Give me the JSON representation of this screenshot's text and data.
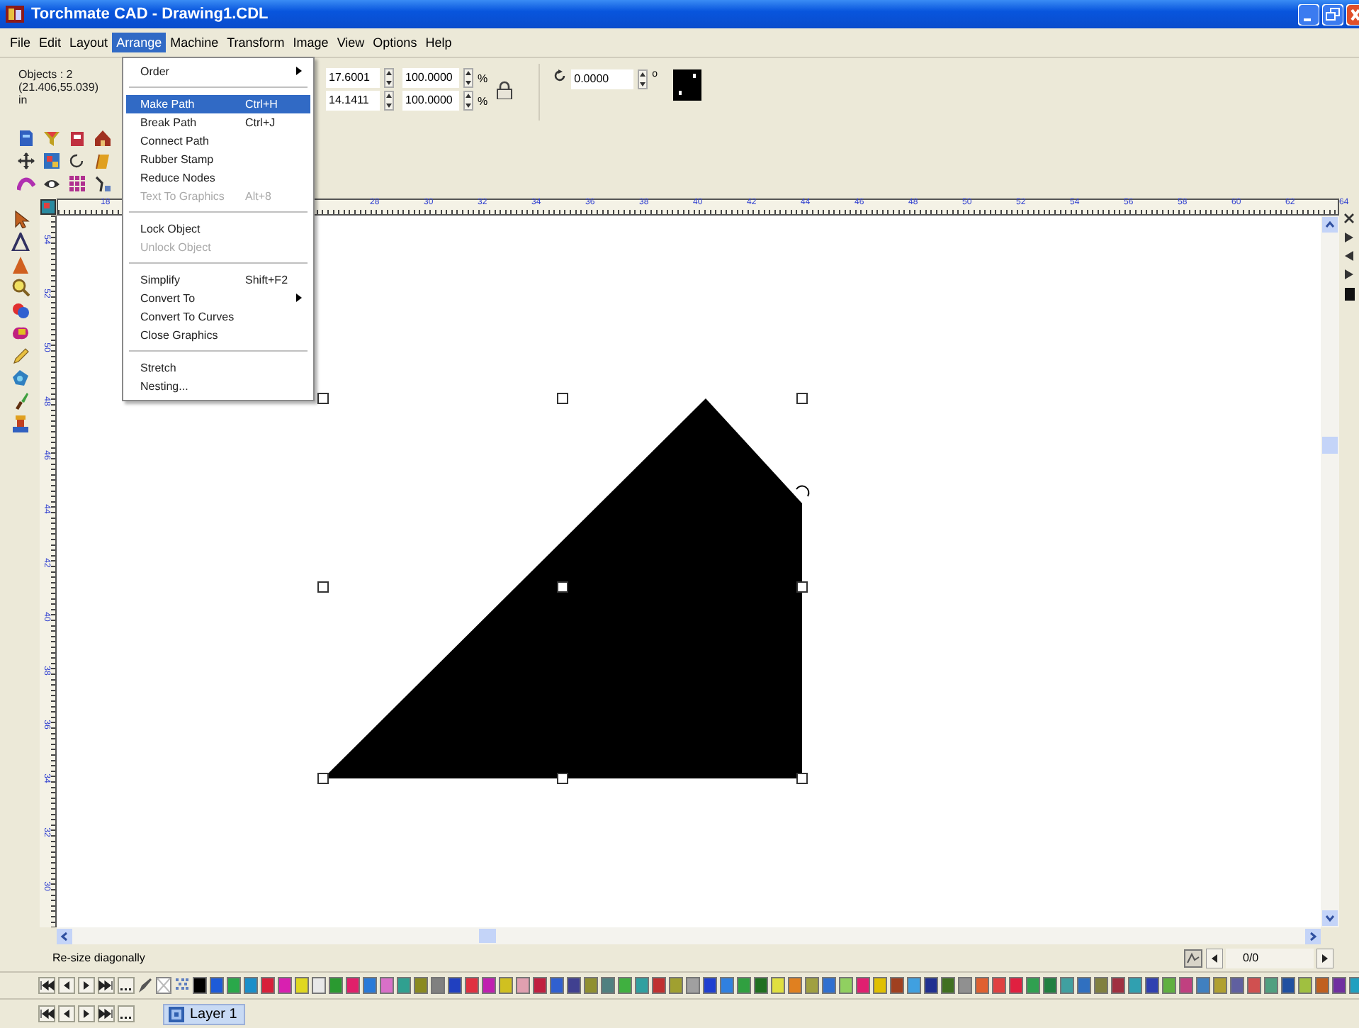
{
  "window": {
    "title": "Torchmate CAD - Drawing1.CDL"
  },
  "menu_bar": [
    {
      "label": "File",
      "selected": false
    },
    {
      "label": "Edit",
      "selected": false
    },
    {
      "label": "Layout",
      "selected": false
    },
    {
      "label": "Arrange",
      "selected": true
    },
    {
      "label": "Machine",
      "selected": false
    },
    {
      "label": "Transform",
      "selected": false
    },
    {
      "label": "Image",
      "selected": false
    },
    {
      "label": "View",
      "selected": false
    },
    {
      "label": "Options",
      "selected": false
    },
    {
      "label": "Help",
      "selected": false
    }
  ],
  "arrange_menu": [
    {
      "kind": "item",
      "label": "Order",
      "submenu": true,
      "selected": false,
      "disabled": false
    },
    {
      "kind": "separator"
    },
    {
      "kind": "item",
      "label": "Make Path",
      "shortcut": "Ctrl+H",
      "selected": true,
      "disabled": false
    },
    {
      "kind": "item",
      "label": "Break Path",
      "shortcut": "Ctrl+J",
      "selected": false,
      "disabled": false
    },
    {
      "kind": "item",
      "label": "Connect Path",
      "selected": false,
      "disabled": false
    },
    {
      "kind": "item",
      "label": "Rubber Stamp",
      "selected": false,
      "disabled": false
    },
    {
      "kind": "item",
      "label": "Reduce Nodes",
      "selected": false,
      "disabled": false
    },
    {
      "kind": "item",
      "label": "Text To Graphics",
      "shortcut": "Alt+8",
      "selected": false,
      "disabled": true
    },
    {
      "kind": "separator"
    },
    {
      "kind": "item",
      "label": "Lock Object",
      "selected": false,
      "disabled": false
    },
    {
      "kind": "item",
      "label": "Unlock Object",
      "selected": false,
      "disabled": true
    },
    {
      "kind": "separator"
    },
    {
      "kind": "item",
      "label": "Simplify",
      "shortcut": "Shift+F2",
      "selected": false,
      "disabled": false
    },
    {
      "kind": "item",
      "label": "Convert To",
      "submenu": true,
      "selected": false,
      "disabled": false
    },
    {
      "kind": "item",
      "label": "Convert To Curves",
      "selected": false,
      "disabled": false
    },
    {
      "kind": "item",
      "label": "Close Graphics",
      "selected": false,
      "disabled": false
    },
    {
      "kind": "separator"
    },
    {
      "kind": "item",
      "label": "Stretch",
      "selected": false,
      "disabled": false
    },
    {
      "kind": "item",
      "label": "Nesting...",
      "selected": false,
      "disabled": false
    }
  ],
  "property_bar": {
    "objects": "Objects : 2",
    "position": "(21.406,55.039)",
    "unit": "in",
    "size_fields": [
      {
        "value": "17.6001",
        "scale": "100.0000",
        "unit": "%"
      },
      {
        "value": "14.1411",
        "scale": "100.0000",
        "unit": "%"
      }
    ],
    "rotation": {
      "value": "0.0000",
      "unit": "o"
    }
  },
  "ruler_top": {
    "segments": [
      [
        "18"
      ],
      [
        "28",
        "30",
        "32",
        "34",
        "36",
        "38",
        "40",
        "42",
        "44",
        "46",
        "48",
        "50",
        "52",
        "54",
        "56",
        "58",
        "60",
        "62",
        "64"
      ]
    ]
  },
  "ruler_left": {
    "labels": [
      "54",
      "52",
      "50",
      "48",
      "46",
      "44",
      "42",
      "40",
      "38",
      "36",
      "34",
      "32",
      "30"
    ]
  },
  "status_bar": {
    "text": "Re-size diagonally",
    "page": "0/0"
  },
  "palette": [
    {
      "color": "#000000"
    },
    {
      "color": "#1e5bd8"
    },
    {
      "color": "#2aa84a"
    },
    {
      "color": "#1b8fc9"
    },
    {
      "color": "#d8203a"
    },
    {
      "color": "#d820b0"
    },
    {
      "color": "#e0d820"
    },
    {
      "color": "#e8e8e8"
    },
    {
      "color": "#2a9a30"
    },
    {
      "color": "#e0206a"
    },
    {
      "color": "#2a7ad8"
    },
    {
      "color": "#d870c8"
    },
    {
      "color": "#30a090"
    },
    {
      "color": "#8a8a20"
    },
    {
      "color": "#808080"
    },
    {
      "color": "#2040c0"
    },
    {
      "color": "#e03040"
    },
    {
      "color": "#c020b0"
    },
    {
      "color": "#d0c020"
    },
    {
      "color": "#e0a0b0"
    },
    {
      "color": "#c02040"
    },
    {
      "color": "#3060d0"
    },
    {
      "color": "#404090"
    },
    {
      "color": "#909030"
    },
    {
      "color": "#508080"
    },
    {
      "color": "#40b040"
    },
    {
      "color": "#30a0a0"
    },
    {
      "color": "#c03030"
    },
    {
      "color": "#a0a030"
    },
    {
      "color": "#a0a0a0"
    },
    {
      "color": "#2040d0"
    },
    {
      "color": "#3080e0"
    },
    {
      "color": "#30a040"
    },
    {
      "color": "#207020"
    },
    {
      "color": "#e0e040"
    },
    {
      "color": "#e08020"
    },
    {
      "color": "#a0a040"
    },
    {
      "color": "#3070d0"
    },
    {
      "color": "#90d060"
    },
    {
      "color": "#e02070"
    },
    {
      "color": "#e0c000"
    },
    {
      "color": "#a04020"
    },
    {
      "color": "#40a0e0"
    },
    {
      "color": "#203090"
    },
    {
      "color": "#407020"
    },
    {
      "color": "#909090"
    },
    {
      "color": "#e06030"
    },
    {
      "color": "#e04040"
    },
    {
      "color": "#e02040"
    },
    {
      "color": "#30a050"
    },
    {
      "color": "#208040"
    },
    {
      "color": "#40a0a0"
    },
    {
      "color": "#3070c0"
    },
    {
      "color": "#808040"
    },
    {
      "color": "#a03040"
    },
    {
      "color": "#30a0b0"
    },
    {
      "color": "#3040b0"
    },
    {
      "color": "#60b040"
    },
    {
      "color": "#c04080"
    },
    {
      "color": "#4080c0"
    },
    {
      "color": "#b0a030"
    },
    {
      "color": "#6060a0"
    },
    {
      "color": "#d05050"
    },
    {
      "color": "#50a080"
    },
    {
      "color": "#2050a0"
    },
    {
      "color": "#a0c040"
    },
    {
      "color": "#c06020"
    },
    {
      "color": "#7030a0"
    },
    {
      "color": "#20a0c0"
    }
  ],
  "layers": [
    {
      "label": "Layer 1",
      "selected": true
    }
  ]
}
